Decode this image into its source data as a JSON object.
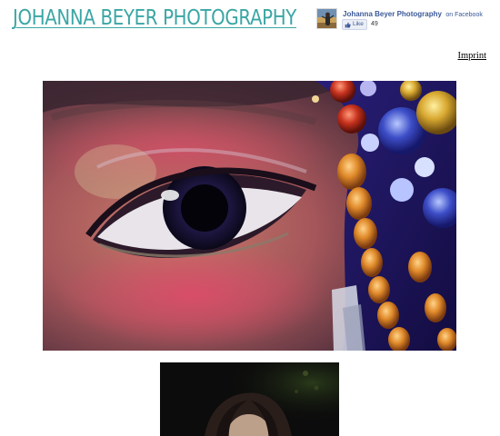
{
  "site": {
    "title": "JOHANNA BEYER PHOTOGRAPHY",
    "title_color": "#3aa6a4"
  },
  "facebook_widget": {
    "page_name": "Johanna Beyer Photography",
    "suffix": "on Facebook",
    "like_label": "Like",
    "like_icon": "thumbs-up-icon",
    "like_count": "49",
    "brand_color": "#3b5998"
  },
  "nav": {
    "imprint_label": "Imprint"
  },
  "gallery": {
    "items": [
      {
        "subject": "close-up of an eye with red eye shadow beside colorful glass beads"
      },
      {
        "subject": "portrait of a woman with dark hair on a dark background"
      }
    ]
  }
}
